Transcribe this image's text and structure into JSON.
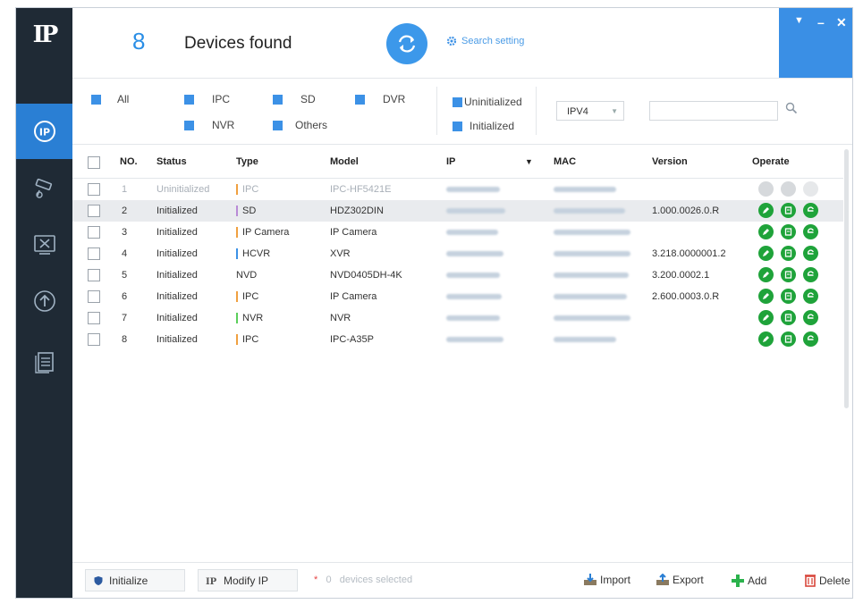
{
  "app": {
    "logo": "IP",
    "device_count": "8",
    "found_label": "Devices found",
    "search_setting": "Search setting",
    "window_controls": [
      "menu-icon",
      "minimize-icon",
      "close-icon"
    ]
  },
  "sidebar": {
    "items": [
      {
        "icon": "ip-icon",
        "active": true
      },
      {
        "icon": "camera-config-icon",
        "active": false
      },
      {
        "icon": "tools-icon",
        "active": false
      },
      {
        "icon": "upgrade-icon",
        "active": false
      },
      {
        "icon": "document-icon",
        "active": false
      }
    ]
  },
  "filters": {
    "all": "All",
    "ipc": "IPC",
    "sd": "SD",
    "dvr": "DVR",
    "nvr": "NVR",
    "others": "Others",
    "uninitialized": "Uninitialized",
    "initialized": "Initialized",
    "ip_version": "IPV4",
    "search_value": ""
  },
  "table": {
    "headers": {
      "no": "NO.",
      "status": "Status",
      "type": "Type",
      "model": "Model",
      "ip": "IP",
      "mac": "MAC",
      "version": "Version",
      "operate": "Operate"
    },
    "rows": [
      {
        "no": "1",
        "status": "Uninitialized",
        "type": "IPC",
        "model": "IPC-HF5421E",
        "version": ""
      },
      {
        "no": "2",
        "status": "Initialized",
        "type": "SD",
        "model": "HDZ302DIN",
        "version": "1.000.0026.0.R"
      },
      {
        "no": "3",
        "status": "Initialized",
        "type": "IP Camera",
        "model": "IP Camera",
        "version": ""
      },
      {
        "no": "4",
        "status": "Initialized",
        "type": "HCVR",
        "model": "XVR",
        "version": "3.218.0000001.2"
      },
      {
        "no": "5",
        "status": "Initialized",
        "type": "NVD",
        "model": "NVD0405DH-4K",
        "version": "3.200.0002.1"
      },
      {
        "no": "6",
        "status": "Initialized",
        "type": "IPC",
        "model": "IP Camera",
        "version": "2.600.0003.0.R"
      },
      {
        "no": "7",
        "status": "Initialized",
        "type": "NVR",
        "model": "NVR",
        "version": ""
      },
      {
        "no": "8",
        "status": "Initialized",
        "type": "IPC",
        "model": "IPC-A35P",
        "version": ""
      }
    ]
  },
  "bottom": {
    "initialize": "Initialize",
    "modify_ip": "Modify IP",
    "selected_count": "0",
    "selected_label": "devices selected",
    "import": "Import",
    "export": "Export",
    "add": "Add",
    "delete": "Delete"
  },
  "colors": {
    "accent": "#3a8fe5",
    "sidebar": "#1f2a35",
    "operate": "#1fa33a"
  }
}
